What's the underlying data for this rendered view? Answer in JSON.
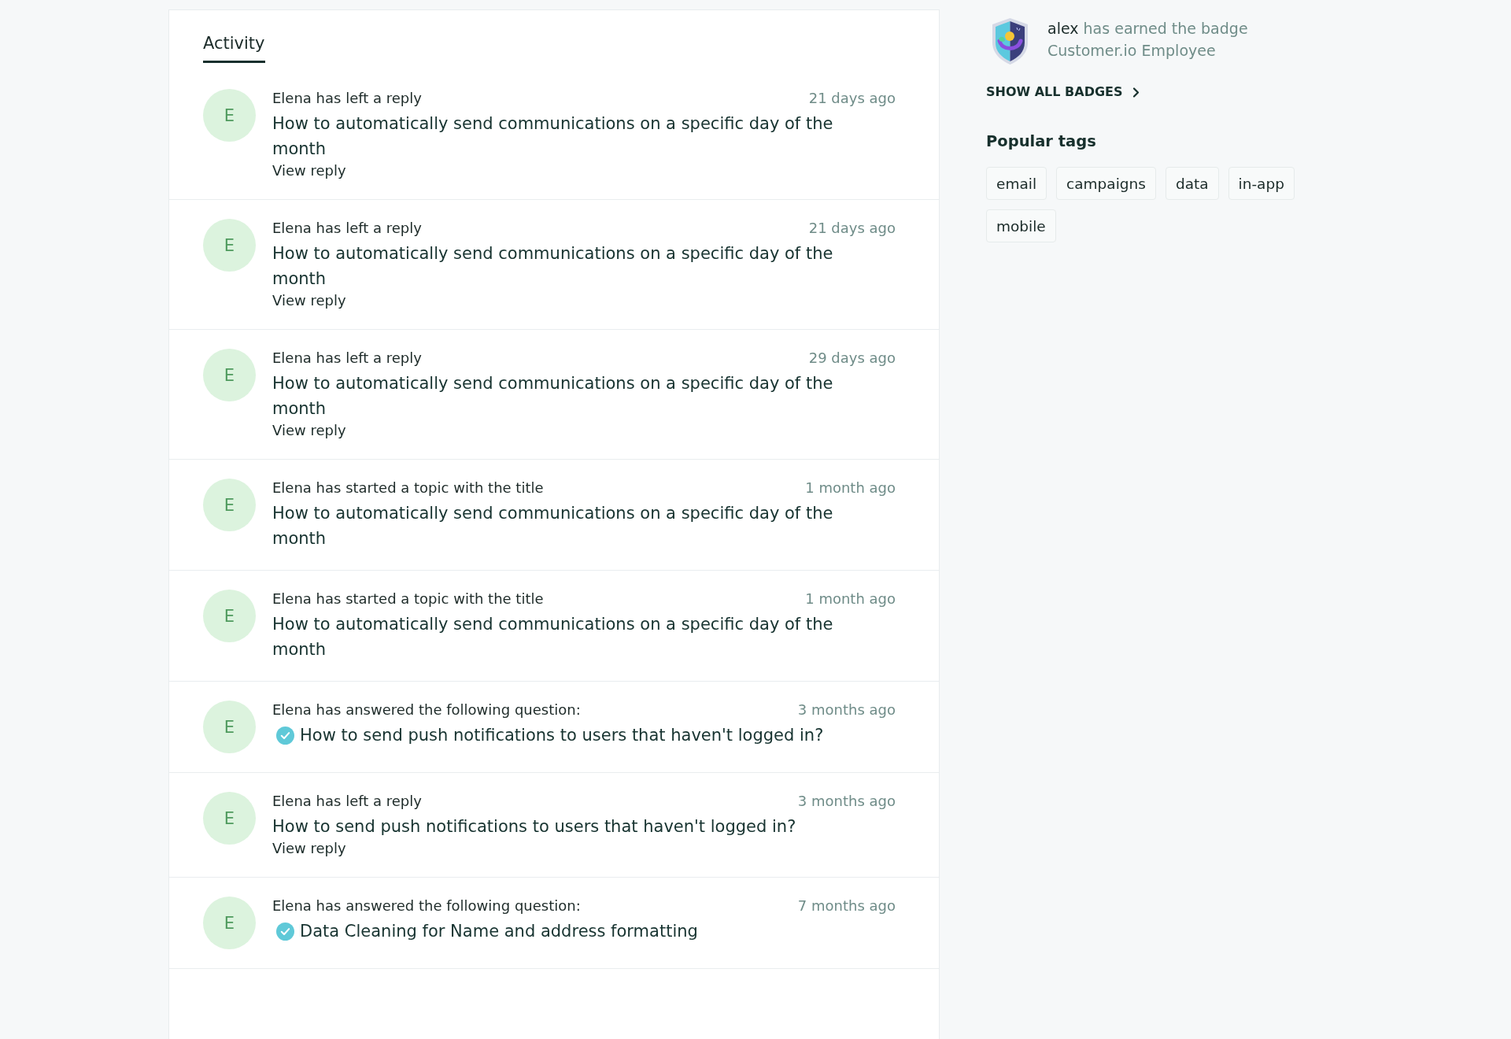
{
  "tabs": [
    {
      "label": "Activity",
      "selected": true
    }
  ],
  "activity": [
    {
      "kind": "reply",
      "avatar": "E",
      "summary": "Elena has left a reply",
      "time": "21 days ago",
      "title": "How to automatically send communications on a specific day of the month",
      "link": "View reply"
    },
    {
      "kind": "reply",
      "avatar": "E",
      "summary": "Elena has left a reply",
      "time": "21 days ago",
      "title": "How to automatically send communications on a specific day of the month",
      "link": "View reply"
    },
    {
      "kind": "reply",
      "avatar": "E",
      "summary": "Elena has left a reply",
      "time": "29 days ago",
      "title": "How to automatically send communications on a specific day of the month",
      "link": "View reply"
    },
    {
      "kind": "topic",
      "avatar": "E",
      "summary": "Elena has started a topic with the title",
      "time": "1 month ago",
      "title": "How to automatically send communications on a specific day of the month"
    },
    {
      "kind": "topic",
      "avatar": "E",
      "summary": "Elena has started a topic with the title",
      "time": "1 month ago",
      "title": "How to automatically send communications on a specific day of the month"
    },
    {
      "kind": "answer",
      "avatar": "E",
      "summary": "Elena has answered the following question:",
      "time": "3 months ago",
      "title": "How to send push notifications to users that haven't logged in?"
    },
    {
      "kind": "reply",
      "avatar": "E",
      "summary": "Elena has left a reply",
      "time": "3 months ago",
      "title": "How to send push notifications to users that haven't logged in?",
      "link": "View reply"
    },
    {
      "kind": "answer",
      "avatar": "E",
      "summary": "Elena has answered the following question:",
      "time": "7 months ago",
      "title": "Data Cleaning for Name and address formatting"
    }
  ],
  "badge_notice": {
    "user": "alex",
    "text": "has earned the badge",
    "badge": "Customer.io Employee"
  },
  "show_all_badges": "SHOW ALL BADGES",
  "popular_tags": {
    "title": "Popular tags",
    "tags": [
      "email",
      "campaigns",
      "data",
      "in-app",
      "mobile"
    ]
  }
}
